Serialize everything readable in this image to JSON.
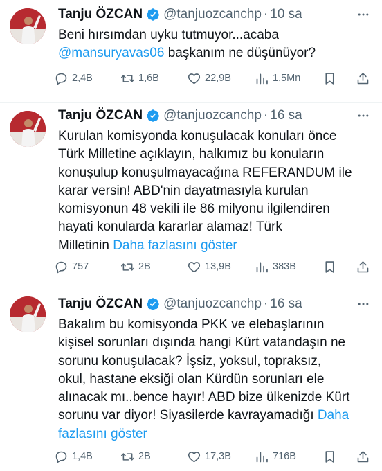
{
  "tweets": [
    {
      "name": "Tanju ÖZCAN",
      "handle": "@tanjuozcanchp",
      "time": "10 sa",
      "text_lines": [
        "Beni hırsımdan uyku tutmuyor...acaba"
      ],
      "mention": "@mansuryavas06",
      "text_after_mention": " başkanım ne düşünüyor?",
      "replies": "2,4B",
      "retweets": "1,6B",
      "likes": "22,9B",
      "views": "1,5Mn"
    },
    {
      "name": "Tanju ÖZCAN",
      "handle": "@tanjuozcanchp",
      "time": "16 sa",
      "text_lines": [
        "Kurulan komisyonda konuşulacak konuları önce",
        "Türk Milletine açıklayın, halkımız bu konuların",
        "konuşulup konuşulmayacağına REFERANDUM ile",
        "karar versin! ABD'nin dayatmasıyla kurulan",
        "komisyonun 48 vekili ile 86 milyonu ilgilendiren",
        "hayati konularda kararlar alamaz! Türk"
      ],
      "last_line": "Milletinin ",
      "show_more": "Daha fazlasını göster",
      "replies": "757",
      "retweets": "2B",
      "likes": "13,9B",
      "views": "383B"
    },
    {
      "name": "Tanju ÖZCAN",
      "handle": "@tanjuozcanchp",
      "time": "16 sa",
      "text_lines": [
        "Bakalım bu komisyonda PKK ve elebaşlarının",
        "kişisel sorunları dışında hangi Kürt vatandaşın ne",
        "sorunu konuşulacak? İşsiz, yoksul, topraksız,",
        "okul, hastane eksiği olan Kürdün sorunları ele",
        "alınacak mı..bence hayır! ABD bize ülkenizde Kürt"
      ],
      "last_line": "sorunu var diyor! Siyasilerde kavrayamadığı ",
      "show_more_part1": "Daha",
      "show_more_part2": "fazlasını göster",
      "replies": "1,4B",
      "retweets": "2B",
      "likes": "17,3B",
      "views": "716B"
    }
  ],
  "colors": {
    "link": "#1d9bf0",
    "muted": "#536471",
    "verified": "#1d9bf0"
  },
  "icons": [
    "more-icon",
    "reply-icon",
    "retweet-icon",
    "like-icon",
    "views-icon",
    "bookmark-icon",
    "share-icon",
    "verified-icon"
  ]
}
